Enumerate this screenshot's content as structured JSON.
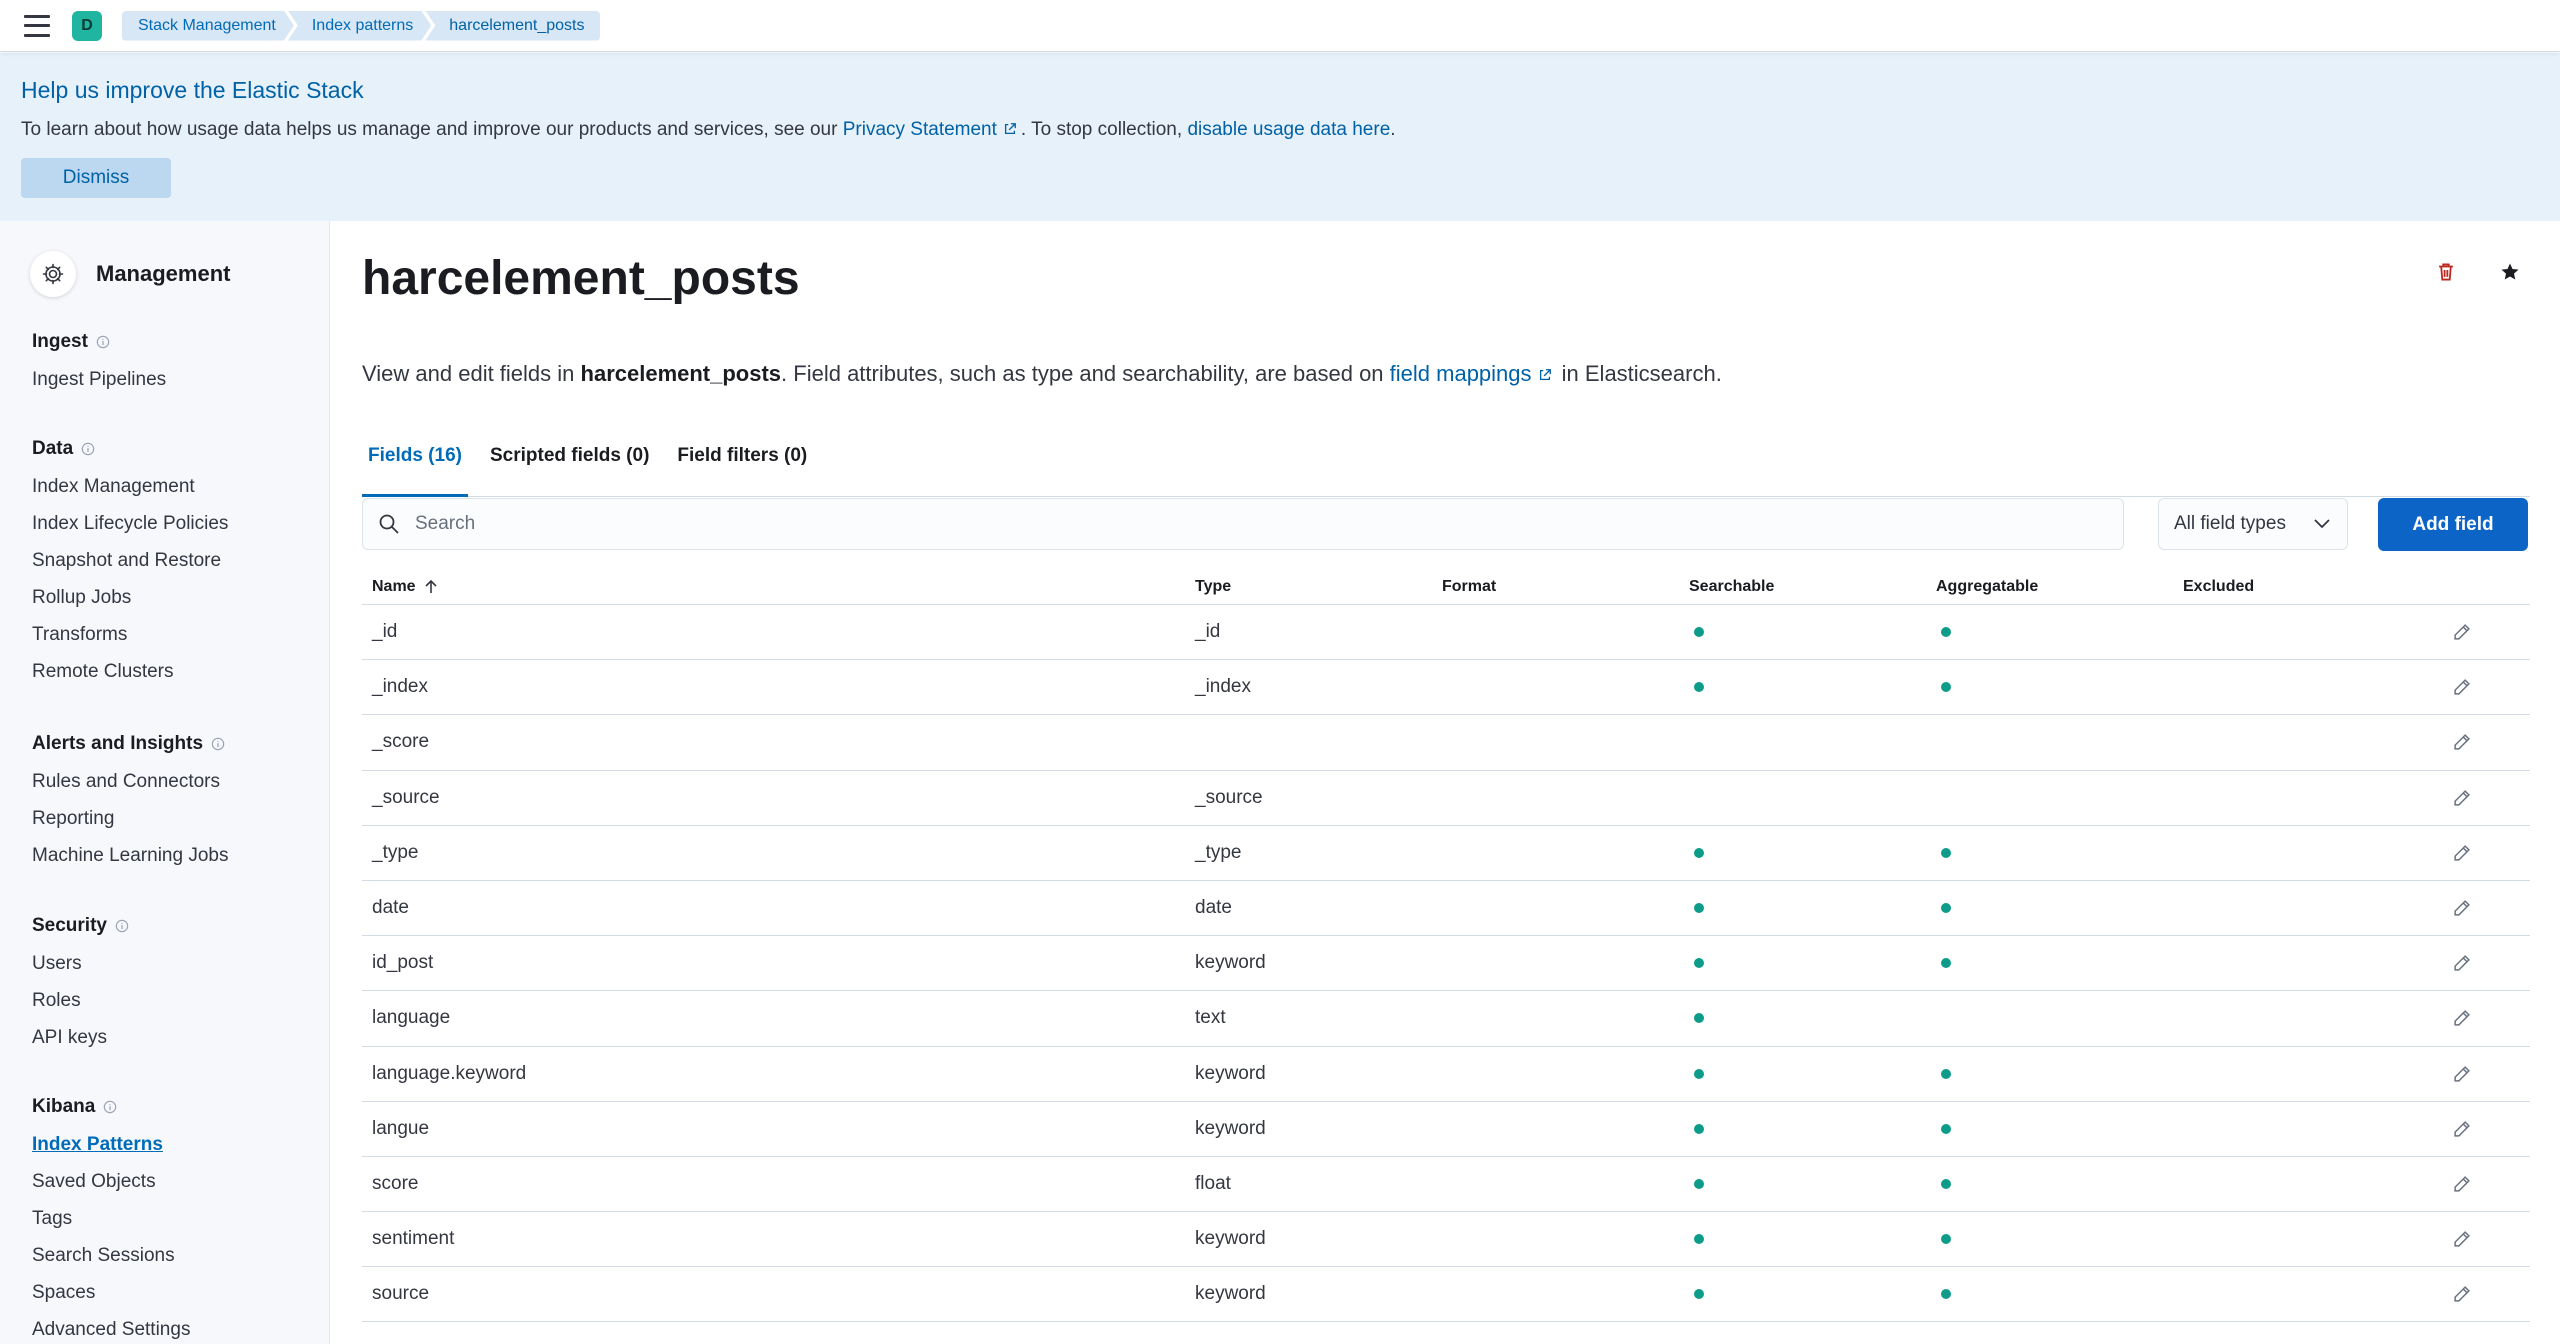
{
  "header": {
    "space_initial": "D",
    "breadcrumbs": [
      "Stack Management",
      "Index patterns",
      "harcelement_posts"
    ]
  },
  "callout": {
    "title": "Help us improve the Elastic Stack",
    "text_before": "To learn about how usage data helps us manage and improve our products and services, see our ",
    "privacy_link": "Privacy Statement",
    "text_middle": ". To stop collection, ",
    "disable_link": "disable usage data here",
    "text_after": ".",
    "dismiss_label": "Dismiss"
  },
  "sidebar": {
    "title": "Management",
    "sections": [
      {
        "heading": "Ingest",
        "items": [
          "Ingest Pipelines"
        ]
      },
      {
        "heading": "Data",
        "items": [
          "Index Management",
          "Index Lifecycle Policies",
          "Snapshot and Restore",
          "Rollup Jobs",
          "Transforms",
          "Remote Clusters"
        ]
      },
      {
        "heading": "Alerts and Insights",
        "items": [
          "Rules and Connectors",
          "Reporting",
          "Machine Learning Jobs"
        ]
      },
      {
        "heading": "Security",
        "items": [
          "Users",
          "Roles",
          "API keys"
        ]
      },
      {
        "heading": "Kibana",
        "items": [
          "Index Patterns",
          "Saved Objects",
          "Tags",
          "Search Sessions",
          "Spaces",
          "Advanced Settings"
        ]
      }
    ],
    "active_item": "Index Patterns"
  },
  "main": {
    "title": "harcelement_posts",
    "description": {
      "before": "View and edit fields in ",
      "bold": "harcelement_posts",
      "middle": ". Field attributes, such as type and searchability, are based on ",
      "link": "field mappings",
      "after": " in Elasticsearch."
    },
    "tabs": [
      "Fields (16)",
      "Scripted fields (0)",
      "Field filters (0)"
    ],
    "search_placeholder": "Search",
    "type_filter": "All field types",
    "add_field_label": "Add field",
    "columns": {
      "name": "Name",
      "type": "Type",
      "format": "Format",
      "searchable": "Searchable",
      "aggregatable": "Aggregatable",
      "excluded": "Excluded"
    },
    "rows": [
      {
        "name": "_id",
        "type": "_id",
        "searchable": true,
        "aggregatable": true
      },
      {
        "name": "_index",
        "type": "_index",
        "searchable": true,
        "aggregatable": true
      },
      {
        "name": "_score",
        "type": "",
        "searchable": false,
        "aggregatable": false
      },
      {
        "name": "_source",
        "type": "_source",
        "searchable": false,
        "aggregatable": false
      },
      {
        "name": "_type",
        "type": "_type",
        "searchable": true,
        "aggregatable": true
      },
      {
        "name": "date",
        "type": "date",
        "searchable": true,
        "aggregatable": true
      },
      {
        "name": "id_post",
        "type": "keyword",
        "searchable": true,
        "aggregatable": true
      },
      {
        "name": "language",
        "type": "text",
        "searchable": true,
        "aggregatable": false
      },
      {
        "name": "language.keyword",
        "type": "keyword",
        "searchable": true,
        "aggregatable": true
      },
      {
        "name": "langue",
        "type": "keyword",
        "searchable": true,
        "aggregatable": true
      },
      {
        "name": "score",
        "type": "float",
        "searchable": true,
        "aggregatable": true
      },
      {
        "name": "sentiment",
        "type": "keyword",
        "searchable": true,
        "aggregatable": true
      },
      {
        "name": "source",
        "type": "keyword",
        "searchable": true,
        "aggregatable": true
      }
    ]
  },
  "colors": {
    "accent": "#006bb8",
    "primary_button": "#0b64c6",
    "callout_bg": "#e6f1fa",
    "dot": "#0e9c8a",
    "delete_icon": "#bd271e"
  },
  "icons": {
    "menu": "hamburger-menu-icon",
    "gear": "gear-icon",
    "delete": "trash-icon",
    "favorite": "star-icon",
    "edit": "pencil-icon",
    "search": "search-icon",
    "sort": "arrow-up-icon",
    "external": "external-link-icon",
    "info": "info-icon"
  }
}
